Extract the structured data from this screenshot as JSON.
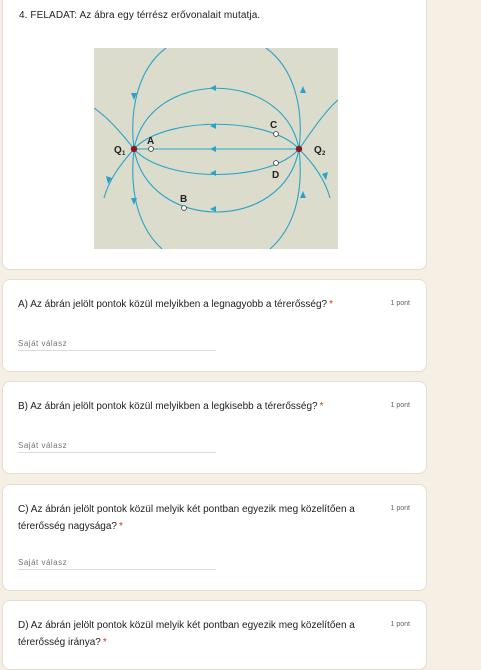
{
  "task": {
    "title": "4. FELADAT: Az ábra egy térrész erővonalait mutatja.",
    "figure": {
      "labels": {
        "q1": "Q",
        "q1_sub": "1",
        "q2": "Q",
        "q2_sub": "2",
        "a": "A",
        "b": "B",
        "c": "C",
        "d": "D"
      },
      "colors": {
        "background": "#dbdccc",
        "field_line": "#2aa3c9",
        "charge": "#8a1a1a"
      }
    }
  },
  "questions": [
    {
      "text": "A) Az ábrán jelölt pontok közül melyikben a legnagyobb a térerősség?",
      "required": "*",
      "points": "1 pont",
      "placeholder": "Saját válasz"
    },
    {
      "text": "B) Az ábrán jelölt pontok közül melyikben a legkisebb a térerősség?",
      "required": "*",
      "points": "1 pont",
      "placeholder": "Saját válasz"
    },
    {
      "text": "C) Az ábrán jelölt pontok közül melyik két pontban egyezik meg közelítően a térerősség nagysága?",
      "required": "*",
      "points": "1 pont",
      "placeholder": "Saját válasz"
    },
    {
      "text": "D) Az ábrán jelölt pontok közül melyik két pontban egyezik meg közelítően a térerősség iránya?",
      "required": "*",
      "points": "1 pont"
    }
  ]
}
